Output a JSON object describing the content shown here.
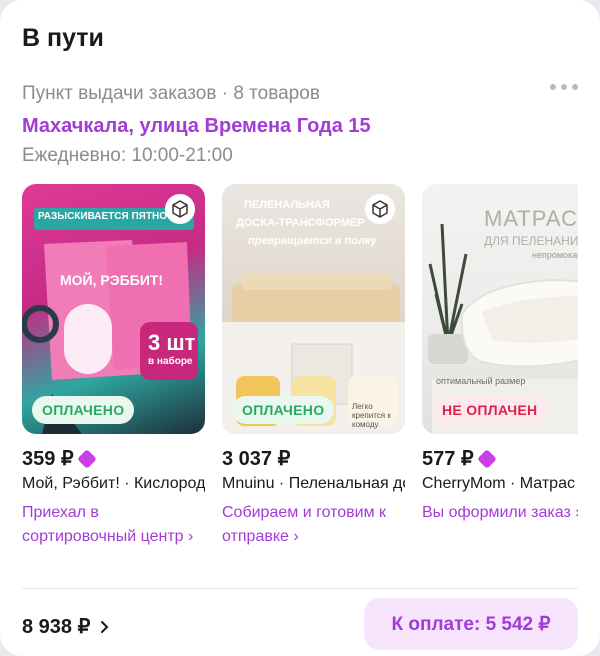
{
  "header": {
    "title": "В пути",
    "subtitle": "Пункт выдачи заказов · 8 товаров"
  },
  "pickup": {
    "address": "Махачкала, улица Времена Года 15",
    "hours": "Ежедневно: 10:00-21:00"
  },
  "items": [
    {
      "price": "359 ₽",
      "has_gem": true,
      "name": "Мой, Рэббит! · Кислородный пятновыводитель",
      "payment_badge": "ОПЛАЧЕНО",
      "status": "Приехал в сортировочный центр ›",
      "thumb_text": {
        "banner": "РАЗЫСКИВАЕТСЯ ПЯТНО",
        "brand": "МОЙ, РЭББИТ!",
        "count": "3 шт",
        "count_sub": "в наборе"
      }
    },
    {
      "price": "3 037 ₽",
      "has_gem": false,
      "name": "Mnuinu · Пеленальная доска-трансформер",
      "payment_badge": "ОПЛАЧЕНО",
      "status": "Собираем и готовим к отправке ›",
      "thumb_text": {
        "line1": "ПЕЛЕНАЛЬНАЯ",
        "line2": "ДОСКА-ТРАНСФОРМЕР",
        "line3": "превращается в полку",
        "note": "Легко крепится к комоду"
      }
    },
    {
      "price": "577 ₽",
      "has_gem": true,
      "name": "CherryMom · Матрас для пеленания",
      "payment_badge": "НЕ ОПЛАЧЕН",
      "status": "Вы оформили заказ ›",
      "thumb_text": {
        "line1": "МАТРАС",
        "line2": "ДЛЯ ПЕЛЕНАНИЯ",
        "line3": "непромокаемый",
        "note": "оптимальный размер"
      }
    }
  ],
  "footer": {
    "total": "8 938 ₽",
    "pay_label": "К оплате: 5 542 ₽"
  },
  "colors": {
    "accent": "#a33bd6",
    "paid": "#2aa862",
    "unpaid": "#d8244a",
    "pay_bg": "#f5e4fb"
  }
}
